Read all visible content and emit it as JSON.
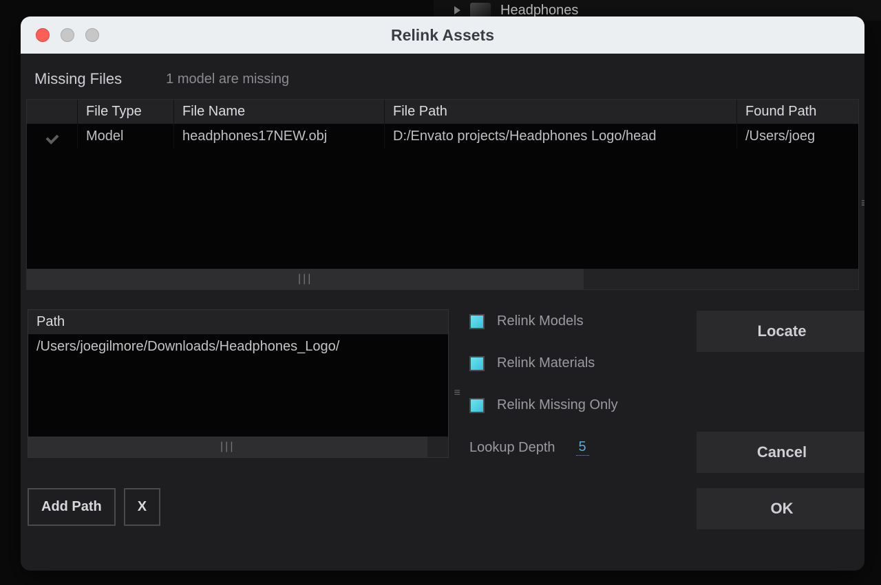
{
  "background": {
    "outliner_item": "Headphones"
  },
  "dialog": {
    "title": "Relink Assets",
    "missing_label": "Missing Files",
    "missing_sub": "1 model are missing"
  },
  "table": {
    "headers": {
      "file_type": "File Type",
      "file_name": "File Name",
      "file_path": "File Path",
      "found_path": "Found Path"
    },
    "rows": [
      {
        "file_type": "Model",
        "file_name": "headphones17NEW.obj",
        "file_path": "D:/Envato projects/Headphones Logo/head",
        "found_path": "/Users/joeg"
      }
    ]
  },
  "path_list": {
    "header": "Path",
    "rows": [
      "/Users/joegilmore/Downloads/Headphones_Logo/"
    ]
  },
  "buttons": {
    "add_path": "Add Path",
    "remove_path": "X",
    "locate": "Locate",
    "cancel": "Cancel",
    "ok": "OK"
  },
  "options": {
    "relink_models": "Relink Models",
    "relink_materials": "Relink Materials",
    "relink_missing_only": "Relink Missing Only",
    "lookup_depth_label": "Lookup Depth",
    "lookup_depth_value": "5"
  },
  "grip_glyph": "≡",
  "scroll_glyph": "|||"
}
